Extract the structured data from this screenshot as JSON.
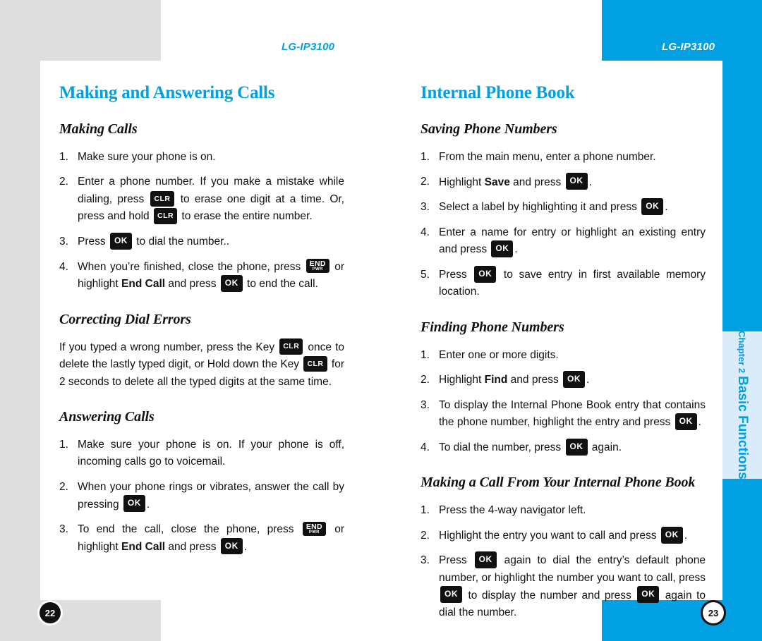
{
  "document": {
    "product_name": "LG-IP3100",
    "running_head_left": "LG-IP3100",
    "running_head_right": "LG-IP3100",
    "page_number_left": "22",
    "page_number_right": "23",
    "accent_color": "#00a0e2",
    "frame_gray": "#dedede",
    "tab_light_blue": "#daebf9"
  },
  "side_tab": {
    "chapter_label": "Chapter 2",
    "chapter_name": "Basic Functions"
  },
  "keys": {
    "ok": "OK",
    "clr": "CLR",
    "end": "END",
    "end_sub": "PWR"
  },
  "left_page": {
    "section_title": "Making and Answering Calls",
    "subsections": [
      {
        "title": "Making Calls",
        "steps": [
          {
            "num": "1.",
            "text": "Make sure your phone is on."
          },
          {
            "num": "2.",
            "text": "Enter a phone number. If you make a mistake while dialing, press [CLR] to erase one digit at a time. Or, press and hold [CLR] to erase the entire number."
          },
          {
            "num": "3.",
            "text": "Press [OK] to dial the number.."
          },
          {
            "num": "4.",
            "text": "When you're finished, close the phone, press [END] or highlight End Call and press [OK] to end the call."
          }
        ]
      },
      {
        "title": "Correcting Dial Errors",
        "paragraph": "If you typed a wrong number, press the Key [CLR] once to delete the lastly typed digit, or Hold down the Key [CLR] for 2 seconds to delete all the typed digits at the same time."
      },
      {
        "title": "Answering Calls",
        "steps": [
          {
            "num": "1.",
            "text": "Make sure your phone is on. If your phone is off, incoming calls go to voicemail."
          },
          {
            "num": "2.",
            "text": "When your phone rings or vibrates, answer the call by pressing [OK]."
          },
          {
            "num": "3.",
            "text": "To end the call, close the phone, press [END] or highlight End Call and press [OK]."
          }
        ]
      }
    ]
  },
  "right_page": {
    "section_title": "Internal Phone Book",
    "subsections": [
      {
        "title": "Saving Phone Numbers",
        "steps": [
          {
            "num": "1.",
            "text": "From the main menu, enter a phone number."
          },
          {
            "num": "2.",
            "text": "Highlight Save and press [OK]."
          },
          {
            "num": "3.",
            "text": "Select a label by highlighting it and press [OK]."
          },
          {
            "num": "4.",
            "text": "Enter a name for entry or highlight an existing entry and press [OK]."
          },
          {
            "num": "5.",
            "text": "Press [OK] to save entry in first available memory location."
          }
        ]
      },
      {
        "title": "Finding Phone Numbers",
        "steps": [
          {
            "num": "1.",
            "text": "Enter one or more digits."
          },
          {
            "num": "2.",
            "text": "Highlight Find and press [OK]."
          },
          {
            "num": "3.",
            "text": "To display the Internal Phone Book entry that contains the phone number, highlight the entry and press [OK]."
          },
          {
            "num": "4.",
            "text": "To dial the number, press [OK] again."
          }
        ]
      },
      {
        "title": "Making a Call From Your Internal Phone Book",
        "steps": [
          {
            "num": "1.",
            "text": "Press the 4-way navigator left."
          },
          {
            "num": "2.",
            "text": "Highlight the entry you want to call and press [OK]."
          },
          {
            "num": "3.",
            "text": "Press [OK] again to dial the entry's default phone number, or highlight the number you want to call, press [OK] to display the number and press [OK] again to dial the number."
          }
        ]
      }
    ]
  }
}
